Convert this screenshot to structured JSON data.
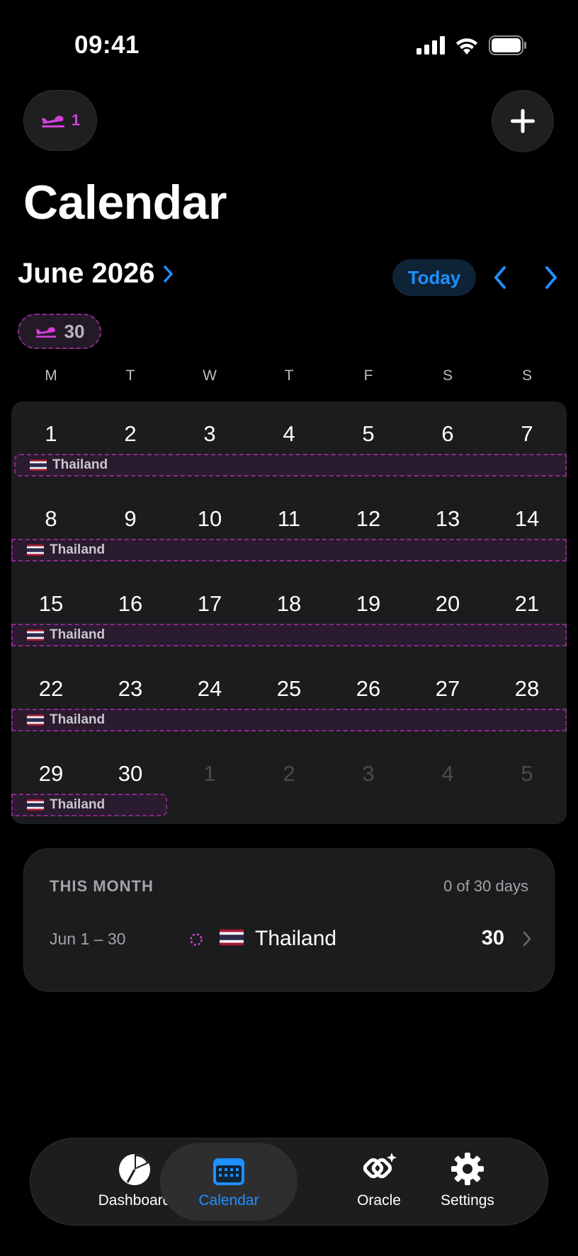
{
  "status_bar": {
    "time": "09:41"
  },
  "header": {
    "trips_count": "1",
    "title": "Calendar"
  },
  "month_nav": {
    "label": "June 2026",
    "today_label": "Today",
    "total_days": "30"
  },
  "weekdays": [
    "M",
    "T",
    "W",
    "T",
    "F",
    "S",
    "S"
  ],
  "weeks": [
    {
      "days": [
        "1",
        "2",
        "3",
        "4",
        "5",
        "6",
        "7"
      ],
      "muted": [
        false,
        false,
        false,
        false,
        false,
        false,
        false
      ],
      "trip": "Thailand"
    },
    {
      "days": [
        "8",
        "9",
        "10",
        "11",
        "12",
        "13",
        "14"
      ],
      "muted": [
        false,
        false,
        false,
        false,
        false,
        false,
        false
      ],
      "trip": "Thailand"
    },
    {
      "days": [
        "15",
        "16",
        "17",
        "18",
        "19",
        "20",
        "21"
      ],
      "muted": [
        false,
        false,
        false,
        false,
        false,
        false,
        false
      ],
      "trip": "Thailand"
    },
    {
      "days": [
        "22",
        "23",
        "24",
        "25",
        "26",
        "27",
        "28"
      ],
      "muted": [
        false,
        false,
        false,
        false,
        false,
        false,
        false
      ],
      "trip": "Thailand"
    },
    {
      "days": [
        "29",
        "30",
        "1",
        "2",
        "3",
        "4",
        "5"
      ],
      "muted": [
        false,
        false,
        true,
        true,
        true,
        true,
        true
      ],
      "trip": "Thailand"
    }
  ],
  "summary": {
    "title": "THIS MONTH",
    "count": "0 of 30 days",
    "row": {
      "range": "Jun 1 – 30",
      "country": "Thailand",
      "days": "30"
    }
  },
  "tabs": [
    {
      "label": "Dashboard",
      "icon": "pie-chart-icon"
    },
    {
      "label": "Calendar",
      "icon": "calendar-icon"
    },
    {
      "label": "Oracle",
      "icon": "oracle-icon"
    },
    {
      "label": "Settings",
      "icon": "gear-icon"
    }
  ],
  "colors": {
    "accent": "#1e90ff",
    "trip": "#d23fd8",
    "trip_border": "#8a2a8e",
    "card": "#1c1c1e"
  }
}
